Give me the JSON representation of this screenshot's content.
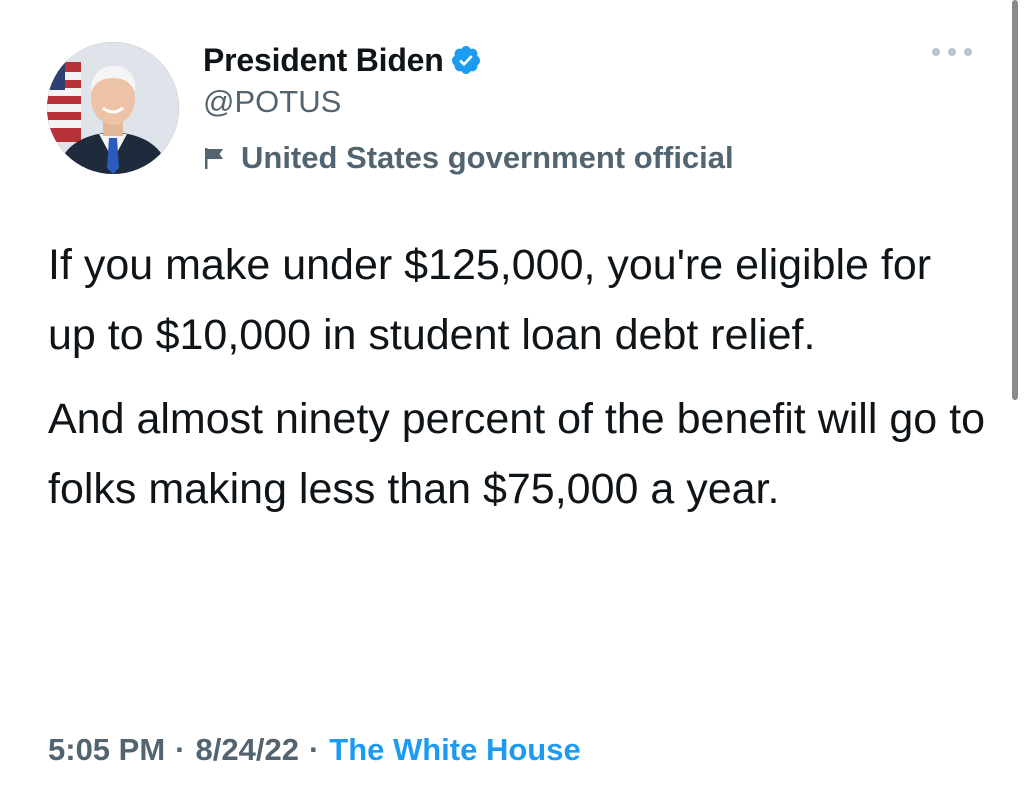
{
  "author": {
    "display_name": "President Biden",
    "handle": "@POTUS",
    "label": "United States government official",
    "verified": true,
    "avatar_icon": "portrait-avatar"
  },
  "tweet": {
    "paragraphs": [
      "If you make under $125,000, you're eligible for up to $10,000 in student loan debt relief.",
      "And almost ninety percent of the benefit will go to folks making less than $75,000 a year."
    ]
  },
  "meta": {
    "time": "5:05 PM",
    "separator_1": "·",
    "date": "8/24/22",
    "separator_2": "·",
    "source": "The White House"
  },
  "icons": {
    "more": "more-options-icon",
    "verified": "verified-badge-icon",
    "government": "flag-icon"
  },
  "colors": {
    "text_primary": "#0f1419",
    "text_secondary": "#536471",
    "accent": "#1d9bf0"
  }
}
